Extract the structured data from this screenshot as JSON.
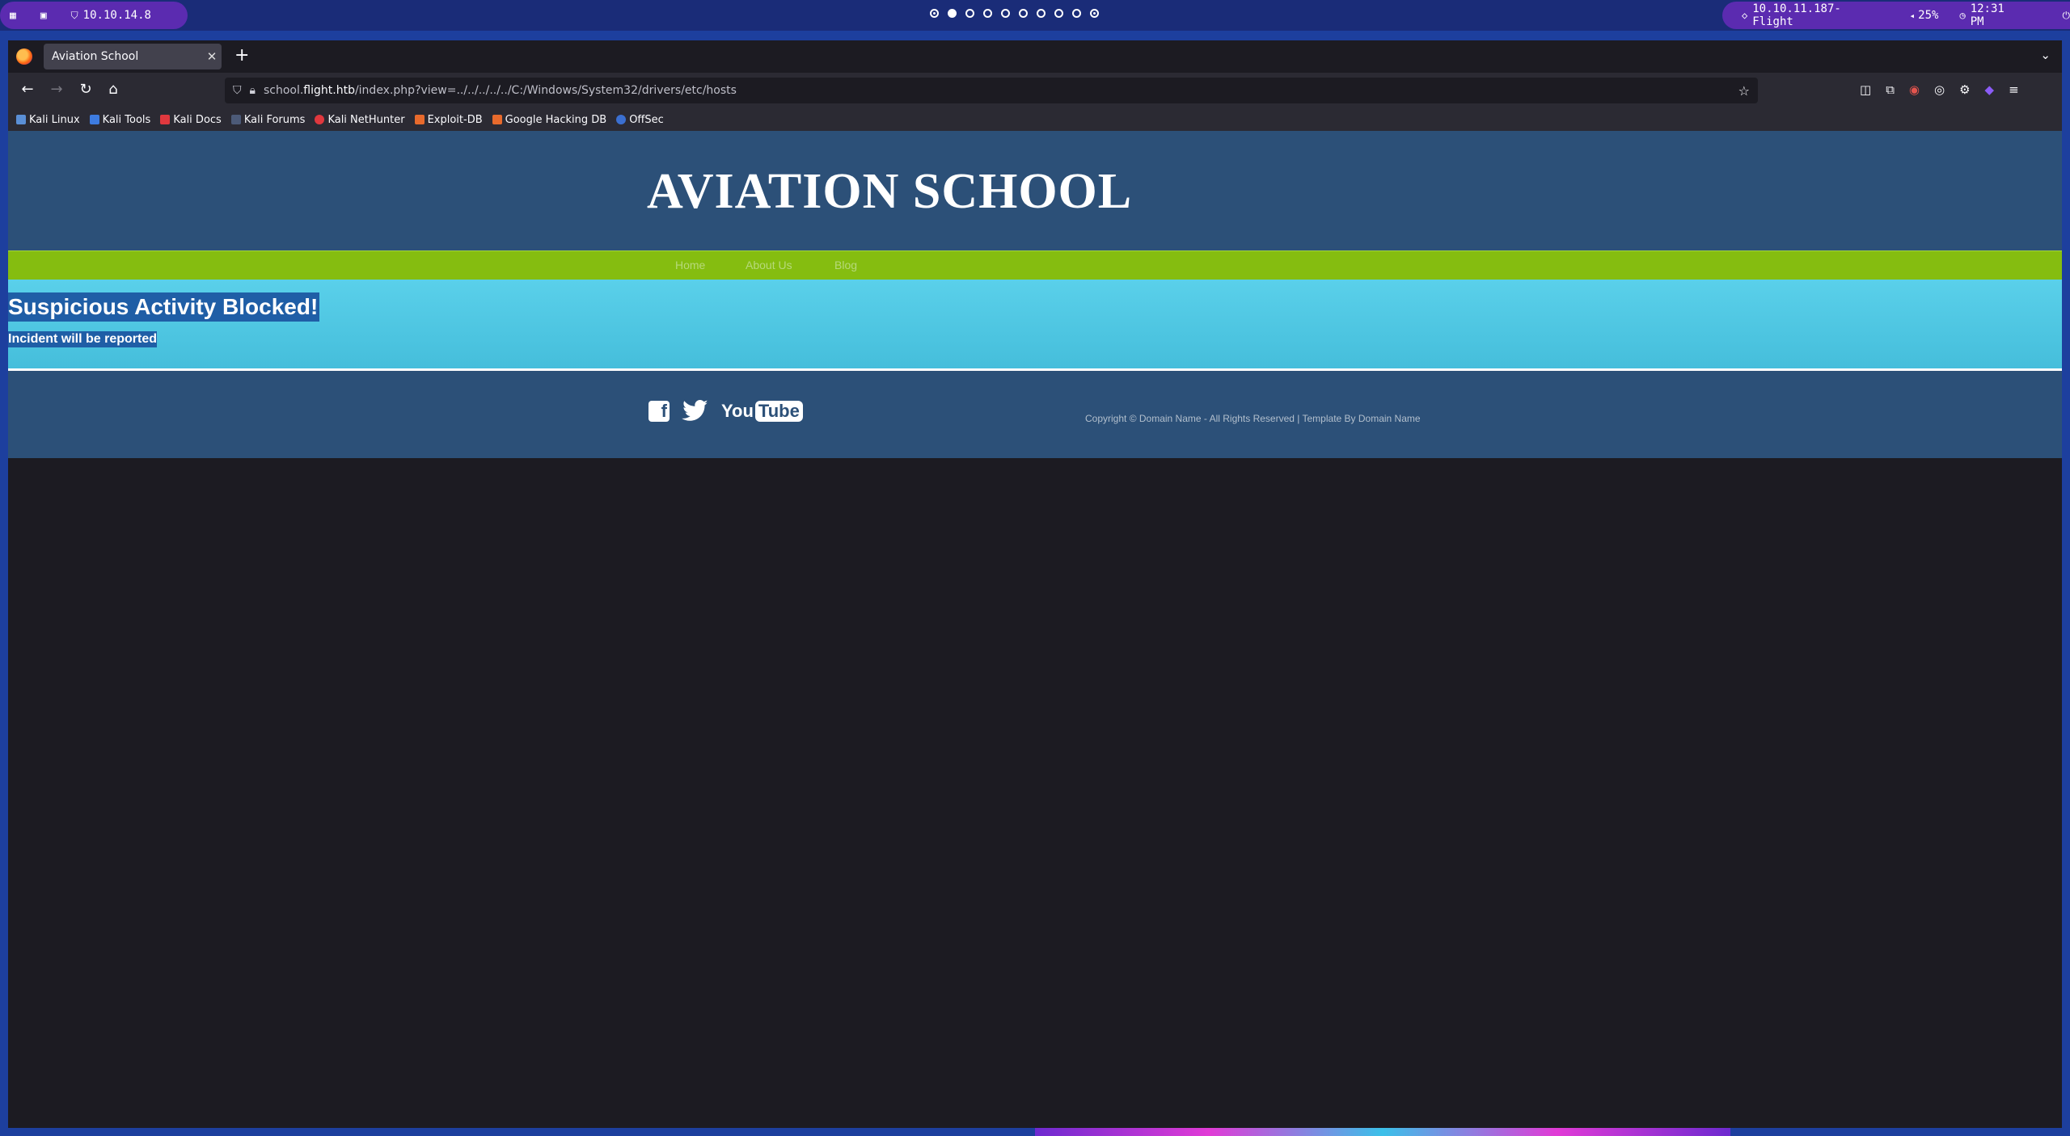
{
  "panel": {
    "left_ip": "10.10.14.8",
    "target": "10.10.11.187-Flight",
    "volume": "25%",
    "clock": "12:31 PM"
  },
  "browser": {
    "tab_title": "Aviation School",
    "url_host": "school.flight.htb",
    "url_path": "/index.php?view=../../../../../C:/Windows/System32/drivers/etc/hosts",
    "url_prefix": "school.",
    "url_domain": "flight.htb",
    "bookmarks": [
      "Kali Linux",
      "Kali Tools",
      "Kali Docs",
      "Kali Forums",
      "Kali NetHunter",
      "Exploit-DB",
      "Google Hacking DB",
      "OffSec"
    ]
  },
  "site": {
    "title": "AVIATION SCHOOL",
    "nav": [
      "Home",
      "About Us",
      "Blog"
    ],
    "alert_heading": "Suspicious Activity Blocked!",
    "alert_text": "Incident will be reported",
    "social_youtube_a": "You",
    "social_youtube_b": "Tube",
    "copyright": "Copyright © Domain Name - All Rights Reserved | Template By Domain Name"
  },
  "colors": {
    "header": "#2c5078",
    "nav": "#85bd10",
    "alert": "#52c9e5"
  }
}
